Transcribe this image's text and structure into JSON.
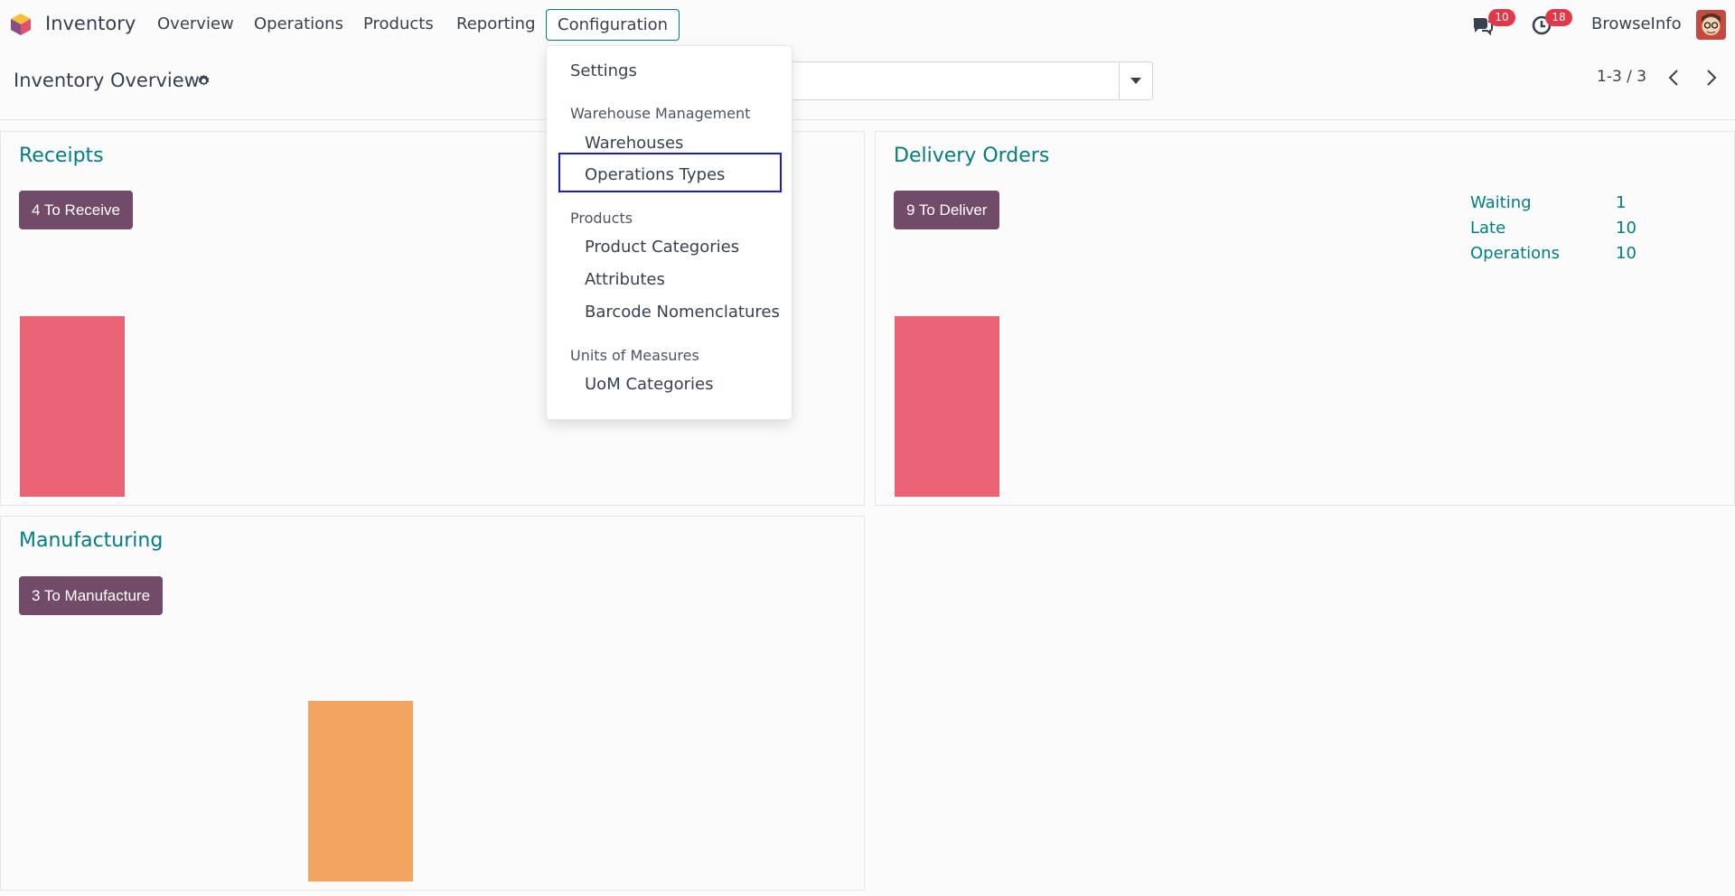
{
  "app": {
    "name": "Inventory"
  },
  "nav": {
    "items": [
      "Overview",
      "Operations",
      "Products",
      "Reporting",
      "Configuration"
    ]
  },
  "systray": {
    "messages_count": "10",
    "activities_count": "18",
    "company": "BrowseInfo"
  },
  "control_panel": {
    "title": "Inventory Overview",
    "pager": "1-3 / 3"
  },
  "config_menu": {
    "settings": "Settings",
    "warehouse_header": "Warehouse Management",
    "warehouses": "Warehouses",
    "operations_types": "Operations Types",
    "products_header": "Products",
    "product_categories": "Product Categories",
    "attributes": "Attributes",
    "barcode_nomenclatures": "Barcode Nomenclatures",
    "uom_header": "Units of Measures",
    "uom_categories": "UoM Categories"
  },
  "cards": {
    "receipts": {
      "title": "Receipts",
      "button": "4 To Receive",
      "bar_color": "#ea6375"
    },
    "delivery": {
      "title": "Delivery Orders",
      "button": "9 To Deliver",
      "bar_color": "#ea6375",
      "stats": [
        {
          "label": "Waiting",
          "value": "1"
        },
        {
          "label": "Late",
          "value": "10"
        },
        {
          "label": "Operations",
          "value": "10"
        }
      ]
    },
    "manufacturing": {
      "title": "Manufacturing",
      "button": "3 To Manufacture",
      "bar_color": "#f3a45f"
    }
  },
  "colors": {
    "accent": "#017e84",
    "brand": "#714b67",
    "badge": "#e4384a"
  }
}
